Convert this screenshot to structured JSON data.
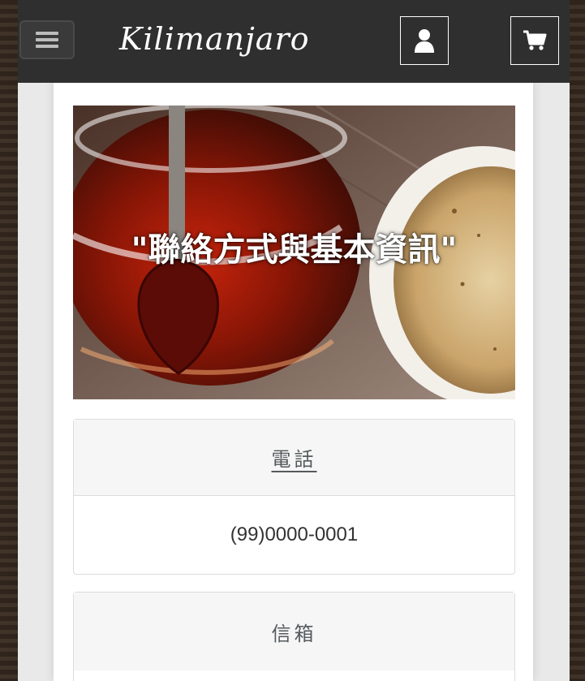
{
  "header": {
    "logo_text": "Kilimanjaro",
    "menu_icon": "hamburger-icon",
    "account_icon": "user-icon",
    "cart_icon": "cart-icon"
  },
  "hero": {
    "title": "\"聯絡方式與基本資訊\""
  },
  "contact": {
    "phone_label": "電話",
    "phone_value": "(99)0000-0001",
    "email_label": "信箱"
  },
  "colors": {
    "topbar": "#2f2f2f",
    "card_header_bg": "#f6f6f6",
    "label_text": "#555a5c"
  }
}
